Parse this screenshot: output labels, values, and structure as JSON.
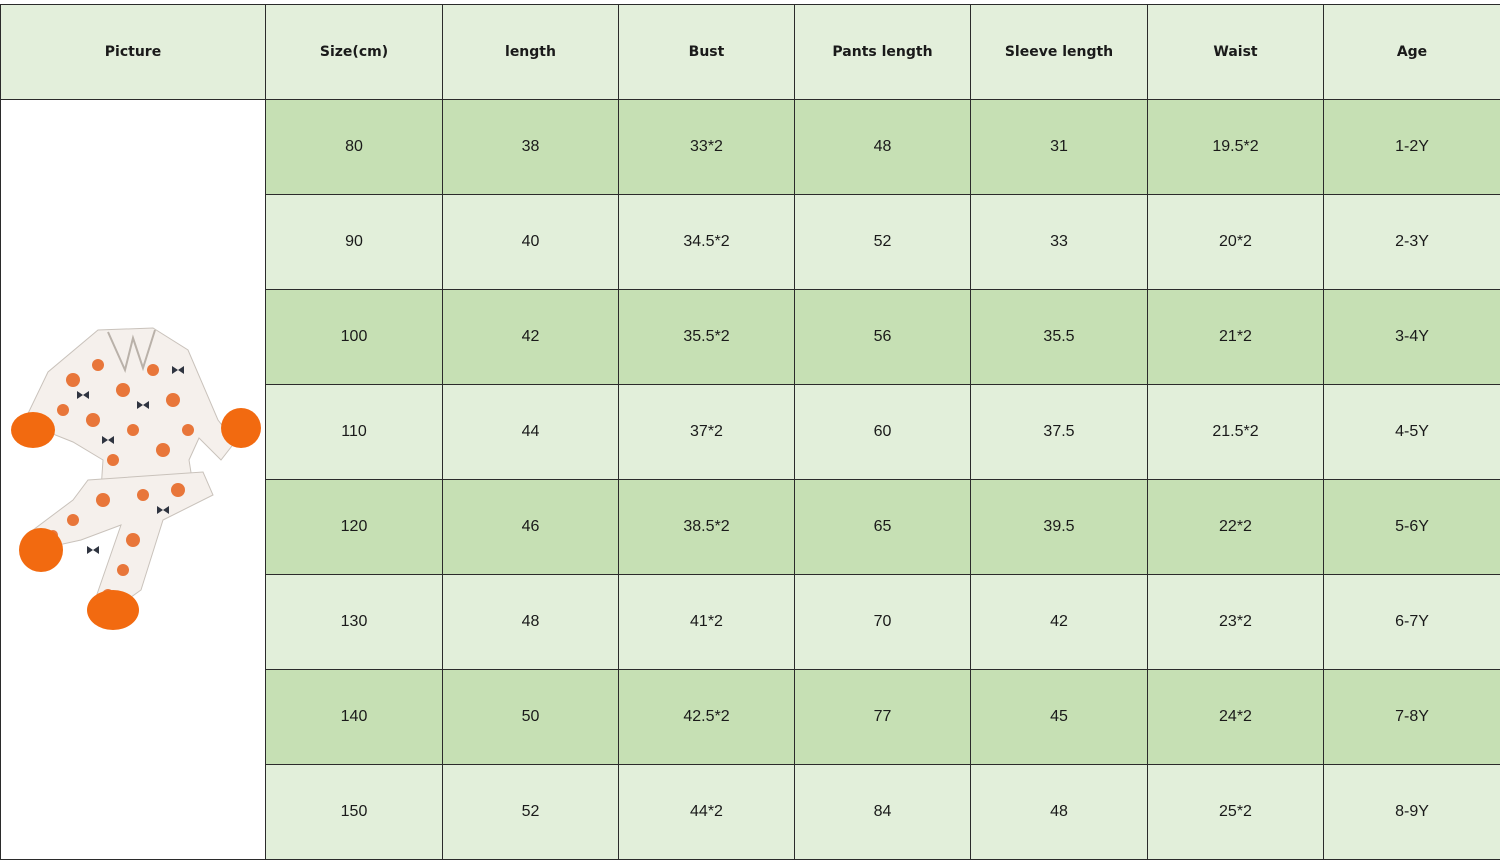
{
  "headers": [
    "Picture",
    "Size(cm)",
    "length",
    "Bust",
    "Pants length",
    "Sleeve length",
    "Waist",
    "Age"
  ],
  "picture": {
    "description_icon": "pumpkin-pajama-set-image",
    "colors": {
      "fur": "#f26a10",
      "fabric": "#f5f0ec",
      "pumpkin": "#e8763a",
      "bow": "#2f3440"
    }
  },
  "rows": [
    {
      "size": "80",
      "length": "38",
      "bust": "33*2",
      "pants": "48",
      "sleeve": "31",
      "waist": "19.5*2",
      "age": "1-2Y"
    },
    {
      "size": "90",
      "length": "40",
      "bust": "34.5*2",
      "pants": "52",
      "sleeve": "33",
      "waist": "20*2",
      "age": "2-3Y"
    },
    {
      "size": "100",
      "length": "42",
      "bust": "35.5*2",
      "pants": "56",
      "sleeve": "35.5",
      "waist": "21*2",
      "age": "3-4Y"
    },
    {
      "size": "110",
      "length": "44",
      "bust": "37*2",
      "pants": "60",
      "sleeve": "37.5",
      "waist": "21.5*2",
      "age": "4-5Y"
    },
    {
      "size": "120",
      "length": "46",
      "bust": "38.5*2",
      "pants": "65",
      "sleeve": "39.5",
      "waist": "22*2",
      "age": "5-6Y"
    },
    {
      "size": "130",
      "length": "48",
      "bust": "41*2",
      "pants": "70",
      "sleeve": "42",
      "waist": "23*2",
      "age": "6-7Y"
    },
    {
      "size": "140",
      "length": "50",
      "bust": "42.5*2",
      "pants": "77",
      "sleeve": "45",
      "waist": "24*2",
      "age": "7-8Y"
    },
    {
      "size": "150",
      "length": "52",
      "bust": "44*2",
      "pants": "84",
      "sleeve": "48",
      "waist": "25*2",
      "age": "8-9Y"
    }
  ],
  "theme": {
    "header_bg": "#e3efdb",
    "row_dark": "#c6e0b4",
    "row_light": "#e2efda",
    "border": "#2b2b2b"
  }
}
